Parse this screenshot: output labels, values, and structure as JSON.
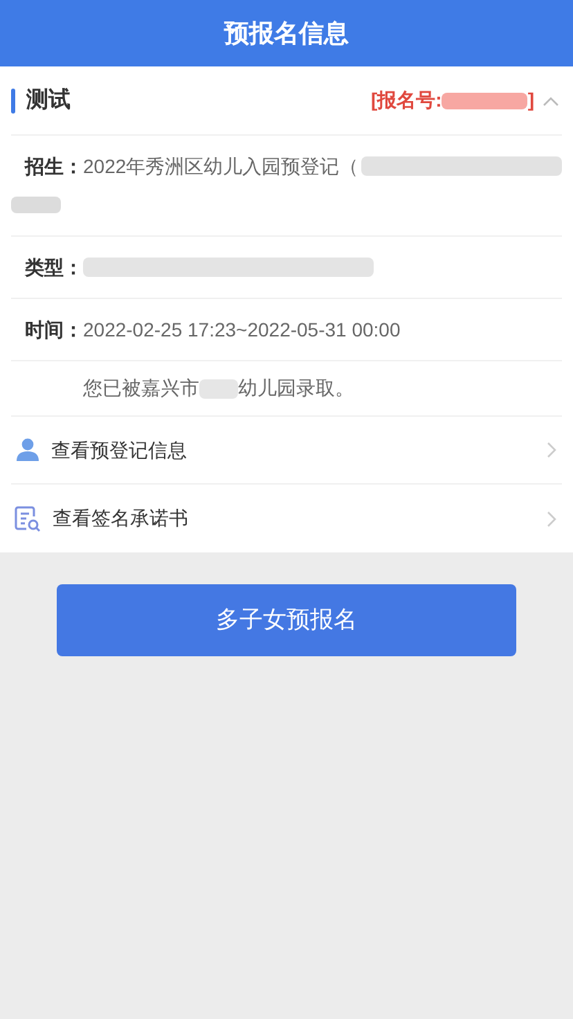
{
  "header": {
    "title": "预报名信息"
  },
  "section": {
    "title": "测试",
    "number_label": "[报名号:",
    "number_end": "]",
    "expanded": true
  },
  "fields": [
    {
      "kind": "enroll",
      "label": "招生：",
      "value": "2022年秀洲区幼儿入园预登记（"
    },
    {
      "kind": "type",
      "label": "类型："
    },
    {
      "kind": "time",
      "label": "时间：",
      "value": "2022-02-25 17:23~2022-05-31 00:00"
    }
  ],
  "notice": {
    "before": "您已被嘉兴市",
    "after": "幼儿园录取。"
  },
  "links": [
    {
      "kind": "person",
      "label": "查看预登记信息"
    },
    {
      "kind": "document",
      "label": "查看签名承诺书"
    }
  ],
  "button": {
    "label": "多子女预报名"
  }
}
